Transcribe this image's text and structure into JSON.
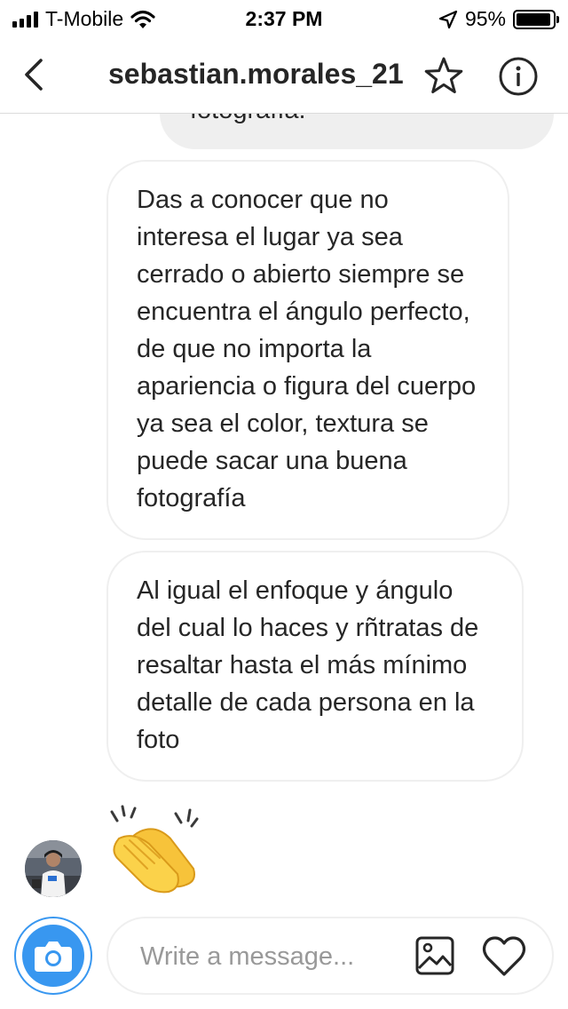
{
  "status_bar": {
    "carrier": "T-Mobile",
    "time": "2:37 PM",
    "battery_percent": "95%",
    "battery_level": 0.95
  },
  "header": {
    "back_icon": "chevron-left-icon",
    "title": "sebastian.morales_21",
    "star_icon": "star-outline-icon",
    "info_icon": "info-circle-icon"
  },
  "messages": [
    {
      "sender": "other",
      "partial": true,
      "text": "fotografía."
    },
    {
      "sender": "other",
      "text": "Das a conocer que no interesa el lugar ya sea cerrado o abierto siempre se encuentra el ángulo perfecto, de que no importa la apariencia o figura del cuerpo ya sea el color, textura se puede sacar una buena fotografía"
    },
    {
      "sender": "other",
      "text": "Al igual el enfoque y ángulo del cual lo haces y rñtratas de resaltar hasta el más mínimo detalle de cada persona en la foto"
    },
    {
      "sender": "other",
      "emoji": "clapping-hands-icon"
    }
  ],
  "composer": {
    "camera_icon": "camera-icon",
    "placeholder": "Write a message...",
    "value": "",
    "gallery_icon": "image-icon",
    "like_icon": "heart-outline-icon"
  },
  "colors": {
    "accent": "#3897f0",
    "bubble_gray": "#efefef",
    "text": "#262626",
    "placeholder": "#999999"
  }
}
